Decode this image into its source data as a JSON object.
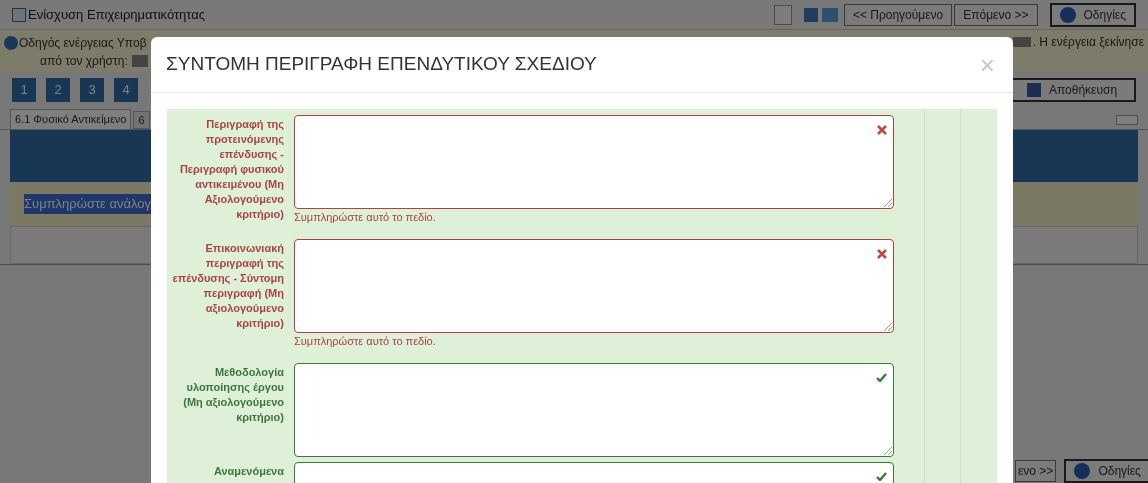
{
  "app": {
    "title": "Ενίσχυση Επιχειρηματικότητας",
    "toolbar": [
      "<< Προηγούμενο",
      "Επόμενο >>"
    ],
    "help": "Οδηγίες",
    "info_left": [
      "Οδηγός ενέργειας Υποβ",
      "από τον χρήστη:"
    ],
    "info_right": ". Η ενέργεια ξεκίνησε",
    "steps": [
      "1",
      "2",
      "3",
      "4"
    ],
    "save": "Αποθήκευση",
    "tabs": [
      {
        "label": "6.1 Φυσικό Αντικείμενο",
        "selected": true
      },
      {
        "label": "6",
        "selected": false
      }
    ],
    "hint": "Συμπληρώστε ανάλογ",
    "bottom_next": "ενο >>",
    "bottom_help": "Οδηγίες"
  },
  "modal": {
    "title": "ΣΥΝΤΟΜΗ ΠΕΡΙΓΡΑΦΗ ΕΠΕΝΔΥΤΙΚΟΥ ΣΧΕΔΙΟΥ",
    "close": "×",
    "fields": [
      {
        "label": "Περιγραφή της προτεινόμενης επένδυσης - Περιγραφή φυσικού αντικειμένου (Μη Αξιολογούμενο κριτήριο)",
        "valid": false,
        "error": "Συμπληρώστε αυτό το πεδίο."
      },
      {
        "label": "Επικοινωνιακή περιγραφή της επένδυσης - Σύντομη περιγραφή (Μη αξιολογούμενο κριτήριο)",
        "valid": false,
        "error": "Συμπληρώστε αυτό το πεδίο."
      },
      {
        "label": "Μεθοδολογία υλοποίησης έργου (Μη αξιολογούμενο κριτήριο)",
        "valid": true
      },
      {
        "label": "Αναμενόμενα",
        "valid": true
      }
    ]
  }
}
